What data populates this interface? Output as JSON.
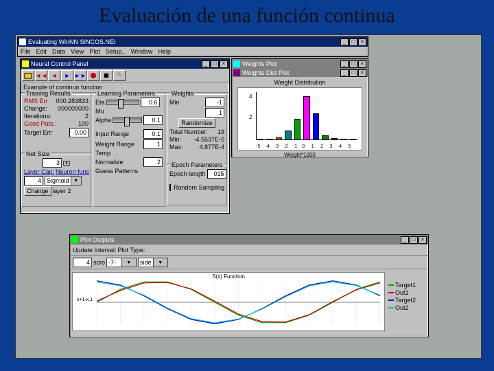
{
  "slide_title": "Evaluación de una función continua",
  "app_win": {
    "title": "Evaluating WinNN SINCOS.NEI",
    "menus": [
      "File",
      "Edit",
      "Data",
      "View",
      "Plot",
      "Setup..",
      "Window",
      "Help"
    ]
  },
  "control_panel": {
    "title": "Neural Control Panel",
    "subtitle": "Example of continuo function",
    "toolbar_icons": [
      "open",
      "prev",
      "next",
      "fwd",
      "stop",
      "record",
      "help",
      "note"
    ],
    "training_results": {
      "legend": "Training Results",
      "rms_label": "RMS Err",
      "rms_value": "000.283833",
      "change_label": "Change:",
      "change_value": "000000000",
      "iterations_label": "Iterations:",
      "iterations_value": "2",
      "goodpats_label": "Good Pats.:",
      "goodpats_value": "100",
      "targeterr_label": "Target Err:",
      "targeterr_value": "0.00"
    },
    "net_size": {
      "legend": "Net Size",
      "value": "3",
      "layercap_label": "Layer Cap:",
      "layercap_value": "4",
      "neuronfunc_label": "Neuron func",
      "neuronfunc_value": "Sigmoid",
      "change_btn": "Change",
      "layer_label": "layer 2"
    },
    "learning_params": {
      "legend": "Learning Parameters",
      "eta_label": "Eta",
      "eta_value": "0.6",
      "alpha_label": "Alpha",
      "alpha_value": "0.1",
      "input_range_label": "Input Range",
      "input_range_value": "0.1",
      "weight_range_label": "Weight Range",
      "weight_range_value": "1",
      "temp_label": "Temp",
      "norm_label": "Normalize",
      "norm_value": "2",
      "guess_label": "Guess Patterns",
      "mu_label": "Mu"
    },
    "weights": {
      "legend": "Weights",
      "min_label": "Min",
      "min_value": "-1",
      "max_input": "1",
      "randomize_btn": "Randomize",
      "total_label": "Total Number:",
      "total_value": "19",
      "min2_label": "Min:",
      "min2_value": "-4.5537E-0",
      "max2_label": "Max:",
      "max2_value": "4.877E-4"
    },
    "epoch": {
      "legend": "Epoch Parameters",
      "len_label": "Epoch length",
      "len_value": "015",
      "sampling_label": "Random Sampling"
    }
  },
  "weights_win": {
    "title": "Weights Plot",
    "subtitle": "Weights Dist Plot",
    "chart_title": "Weight Distribution",
    "xlabel": "Weight*1000",
    "yticks": [
      "2",
      "4"
    ]
  },
  "plot_win": {
    "title": "Plot Outputs",
    "update_label": "Update Interval:",
    "update_value": "4",
    "scroll_label": "scro",
    "plottype_label": "Plot Type:",
    "plottype_value": "-7-",
    "side_label": "side",
    "chart_title": "S(x) Function",
    "xlabel": "x+1-x,1",
    "legend_items": [
      "Target1",
      "Out1",
      "Target2",
      "Out2"
    ]
  },
  "chart_data": [
    {
      "type": "bar",
      "title": "Weight Distribution",
      "xlabel": "Weight*1000",
      "ylabel": "",
      "ylim": [
        0,
        5
      ],
      "categories": [
        "-5",
        "-4",
        "-3",
        "-2",
        "-1",
        "0",
        "1",
        "2",
        "3",
        "4",
        "5"
      ],
      "series": [
        {
          "name": "weights",
          "values": [
            0,
            0,
            0.3,
            1.0,
            2.2,
            4.6,
            2.8,
            0.5,
            0.2,
            0,
            0
          ]
        }
      ],
      "colors": [
        "#800000",
        "#000080",
        "#808000",
        "#008080",
        "#00a000",
        "#ff00ff",
        "#0000ff",
        "#008000",
        "#800080",
        "#404000",
        "#004040"
      ]
    },
    {
      "type": "line",
      "title": "S(x) Function",
      "xlabel": "x+1-x,1",
      "ylabel": "",
      "xlim": [
        0,
        60
      ],
      "ylim": [
        -1,
        1
      ],
      "series": [
        {
          "name": "Target1",
          "color": "#00a000",
          "x": [
            0,
            5,
            10,
            15,
            20,
            25,
            30,
            35,
            40,
            45,
            50,
            55,
            60
          ],
          "y": [
            0,
            0.6,
            0.95,
            0.95,
            0.6,
            0,
            -0.6,
            -0.95,
            -0.95,
            -0.6,
            0,
            0.6,
            0.95
          ]
        },
        {
          "name": "Out1",
          "color": "#c00000",
          "x": [
            0,
            5,
            10,
            15,
            20,
            25,
            30,
            35,
            40,
            45,
            50,
            55,
            60
          ],
          "y": [
            0.06,
            0.55,
            0.9,
            0.92,
            0.62,
            0.05,
            -0.55,
            -0.9,
            -0.92,
            -0.58,
            0.03,
            0.58,
            0.9
          ]
        },
        {
          "name": "Target2",
          "color": "#0000c0",
          "x": [
            0,
            5,
            10,
            15,
            20,
            25,
            30,
            35,
            40,
            45,
            50,
            55,
            60
          ],
          "y": [
            1,
            0.8,
            0.3,
            -0.3,
            -0.8,
            -1,
            -0.8,
            -0.3,
            0.3,
            0.8,
            1,
            0.8,
            0.3
          ]
        },
        {
          "name": "Out2",
          "color": "#00c0c0",
          "x": [
            0,
            5,
            10,
            15,
            20,
            25,
            30,
            35,
            40,
            45,
            50,
            55,
            60
          ],
          "y": [
            0.94,
            0.77,
            0.33,
            -0.27,
            -0.76,
            -0.96,
            -0.78,
            -0.32,
            0.26,
            0.76,
            0.95,
            0.78,
            0.33
          ]
        }
      ]
    }
  ]
}
